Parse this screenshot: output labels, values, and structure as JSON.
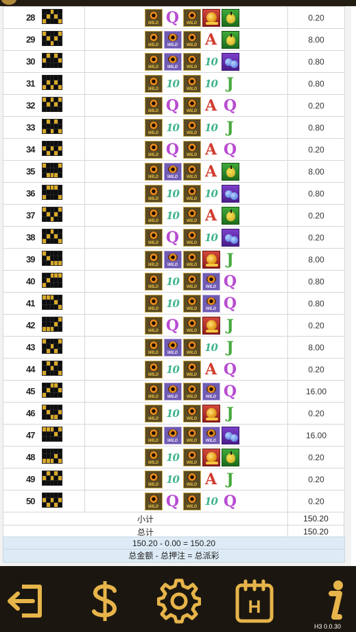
{
  "rows": [
    {
      "line": "28",
      "pattern": "wwgww wgwgw gwwwg",
      "reels": [
        "W",
        "Q",
        "W",
        "G",
        "L"
      ],
      "win": "0.20"
    },
    {
      "line": "29",
      "pattern": "gwwwg wgwgw wwgww",
      "reels": [
        "W",
        "P",
        "W",
        "A",
        "L"
      ],
      "win": "8.00"
    },
    {
      "line": "30",
      "pattern": "wgwgw gwwwg wwwww",
      "reels": [
        "W",
        "P",
        "W",
        "T",
        "B"
      ],
      "win": "0.80"
    },
    {
      "line": "31",
      "pattern": "wwwww wgwgw gwgwg",
      "reels": [
        "W",
        "T",
        "W",
        "T",
        "J"
      ],
      "win": "0.80"
    },
    {
      "line": "32",
      "pattern": "gwgwg wgwgw wwwww",
      "reels": [
        "W",
        "Q",
        "W",
        "A",
        "Q"
      ],
      "win": "0.20"
    },
    {
      "line": "33",
      "pattern": "wgwgw wwwww gwgwg",
      "reels": [
        "W",
        "T",
        "W",
        "T",
        "J"
      ],
      "win": "0.80"
    },
    {
      "line": "34",
      "pattern": "wwwww gwgwg wgwgw",
      "reels": [
        "W",
        "Q",
        "W",
        "A",
        "Q"
      ],
      "win": "0.20"
    },
    {
      "line": "35",
      "pattern": "gwwwg wwwww wgggw",
      "reels": [
        "W",
        "P",
        "W",
        "A",
        "L"
      ],
      "win": "8.00"
    },
    {
      "line": "36",
      "pattern": "wgggw wwwww gwwwg",
      "reels": [
        "W",
        "T",
        "W",
        "T",
        "B"
      ],
      "win": "0.80"
    },
    {
      "line": "37",
      "pattern": "gwwwg wgwgw wwgww",
      "reels": [
        "W",
        "T",
        "W",
        "A",
        "L"
      ],
      "win": "0.20"
    },
    {
      "line": "38",
      "pattern": "wwgww wgwgw gwwwg",
      "reels": [
        "W",
        "Q",
        "W",
        "T",
        "B"
      ],
      "win": "0.20"
    },
    {
      "line": "39",
      "pattern": "gwwww wgwww wwggg",
      "reels": [
        "W",
        "P",
        "W",
        "G",
        "J"
      ],
      "win": "8.00"
    },
    {
      "line": "40",
      "pattern": "wwggg wgwww gwwww",
      "reels": [
        "W",
        "T",
        "W",
        "P",
        "Q"
      ],
      "win": "0.80"
    },
    {
      "line": "41",
      "pattern": "gggww wwwgw wwwwg",
      "reels": [
        "W",
        "T",
        "W",
        "P",
        "Q"
      ],
      "win": "0.80"
    },
    {
      "line": "42",
      "pattern": "wwwwg wwwgw gggww",
      "reels": [
        "W",
        "Q",
        "W",
        "G",
        "J"
      ],
      "win": "0.20"
    },
    {
      "line": "43",
      "pattern": "gwwwg wwgww wgwgw",
      "reels": [
        "W",
        "P",
        "W",
        "T",
        "J"
      ],
      "win": "8.00"
    },
    {
      "line": "44",
      "pattern": "wgwgw wwgww gwwwg",
      "reels": [
        "W",
        "T",
        "W",
        "A",
        "Q"
      ],
      "win": "0.20"
    },
    {
      "line": "45",
      "pattern": "wwggw wgwwg gwwww",
      "reels": [
        "W",
        "P",
        "W",
        "P",
        "Q"
      ],
      "win": "16.00"
    },
    {
      "line": "46",
      "pattern": "gwwww wgwwg wwggw",
      "reels": [
        "W",
        "T",
        "W",
        "G",
        "J"
      ],
      "win": "0.20"
    },
    {
      "line": "47",
      "pattern": "gggwg wwwgw wwwww",
      "reels": [
        "W",
        "P",
        "W",
        "P",
        "B"
      ],
      "win": "16.00"
    },
    {
      "line": "48",
      "pattern": "wwwww wwwgw gggwg",
      "reels": [
        "W",
        "T",
        "W",
        "G",
        "L"
      ],
      "win": "0.20"
    },
    {
      "line": "49",
      "pattern": "wgwgw gwgwg wwwww",
      "reels": [
        "W",
        "T",
        "W",
        "A",
        "J"
      ],
      "win": "0.20"
    },
    {
      "line": "50",
      "pattern": "wwwww gwgwg wgwgw",
      "reels": [
        "W",
        "Q",
        "W",
        "T",
        "Q"
      ],
      "win": "0.20"
    }
  ],
  "symbols": {
    "W": "wild-eye-gold-icon",
    "P": "wild-eye-purple-icon",
    "Q": "queen-q-icon",
    "A": "ace-a-icon",
    "J": "jack-j-icon",
    "T": "ten-icon",
    "G": "gold-coin-icon",
    "L": "lantern-bag-icon",
    "B": "gem-cluster-icon"
  },
  "summary": {
    "subtotal_label": "小计",
    "subtotal_value": "150.20",
    "total_label": "总计",
    "total_value": "150.20",
    "equation": "150.20 - 0.00 = 150.20",
    "legend": "总金额 - 总押注 = 总派彩"
  },
  "toolbar": {
    "buttons": [
      "exit-icon",
      "dollar-icon",
      "gear-icon",
      "history-icon",
      "info-icon"
    ],
    "history_label": "H",
    "version": "H3 0.0.30",
    "accent": "#e7b44a"
  }
}
